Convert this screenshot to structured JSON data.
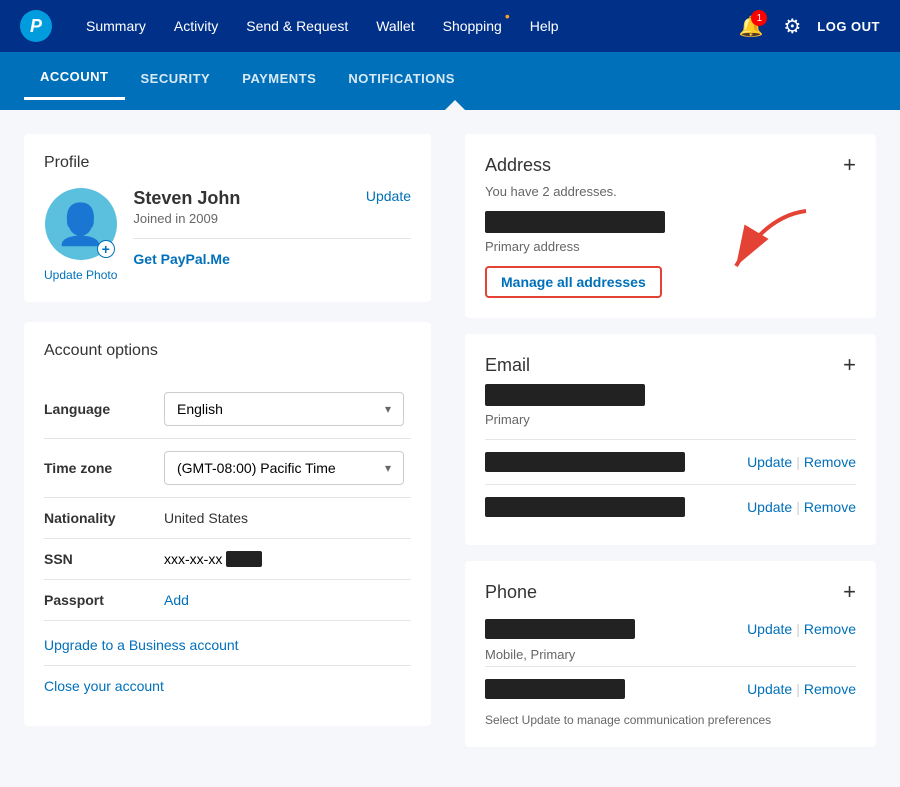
{
  "topNav": {
    "logo": "P",
    "links": [
      {
        "label": "Summary",
        "active": false
      },
      {
        "label": "Activity",
        "active": false
      },
      {
        "label": "Send & Request",
        "active": false
      },
      {
        "label": "Wallet",
        "active": false
      },
      {
        "label": "Shopping",
        "active": false,
        "hasDot": true
      },
      {
        "label": "Help",
        "active": false
      }
    ],
    "notificationCount": "1",
    "logoutLabel": "LOG OUT"
  },
  "subNav": {
    "links": [
      {
        "label": "ACCOUNT",
        "active": true
      },
      {
        "label": "SECURITY",
        "active": false
      },
      {
        "label": "PAYMENTS",
        "active": false
      },
      {
        "label": "NOTIFICATIONS",
        "active": false
      }
    ]
  },
  "profile": {
    "sectionTitle": "Profile",
    "name": "Steven John",
    "joinedText": "Joined in 2009",
    "updateLabel": "Update",
    "getPaypalMe": "Get PayPal.Me",
    "updatePhotoLabel": "Update Photo"
  },
  "accountOptions": {
    "sectionTitle": "Account options",
    "rows": [
      {
        "label": "Language",
        "type": "select",
        "value": "English"
      },
      {
        "label": "Time zone",
        "type": "select",
        "value": "(GMT-08:00) Pacific Time"
      },
      {
        "label": "Nationality",
        "type": "text",
        "value": "United States"
      },
      {
        "label": "SSN",
        "type": "ssn",
        "value": "xxx-xx-xx"
      },
      {
        "label": "Passport",
        "type": "link",
        "value": "Add"
      }
    ],
    "upgradeLabel": "Upgrade to a Business account",
    "closeLabel": "Close your account"
  },
  "addressSection": {
    "title": "Address",
    "subtitle": "You have 2 addresses.",
    "addIcon": "+",
    "primaryLabel": "Primary address",
    "manageLabel": "Manage all addresses"
  },
  "emailSection": {
    "title": "Email",
    "addIcon": "+",
    "primaryLabel": "Primary",
    "rows": [
      {
        "label": "",
        "actions": [
          "Update",
          "Remove"
        ]
      },
      {
        "label": "",
        "actions": [
          "Update",
          "Remove"
        ]
      }
    ]
  },
  "phoneSection": {
    "title": "Phone",
    "addIcon": "+",
    "rows": [
      {
        "label": "Mobile, Primary",
        "actions": [
          "Update",
          "Remove"
        ]
      },
      {
        "label": "",
        "actions": [
          "Update",
          "Remove"
        ]
      }
    ],
    "note": "Select Update to manage communication preferences"
  }
}
